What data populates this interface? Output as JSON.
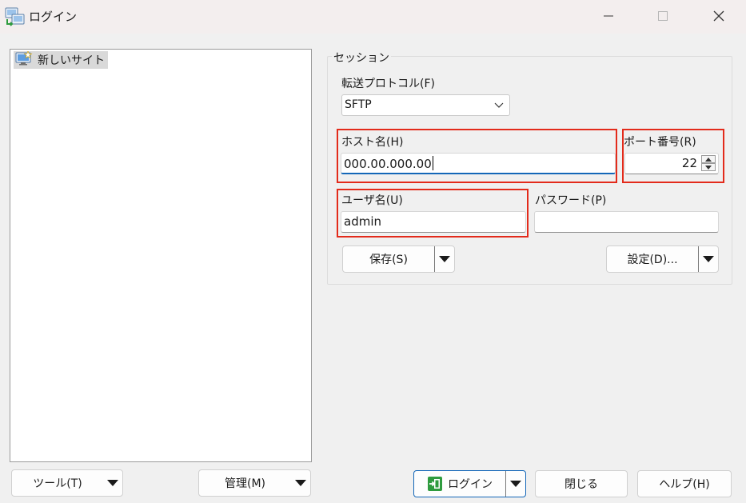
{
  "window": {
    "title": "ログイン",
    "controls": [
      "minimize-icon",
      "maximize-icon",
      "close-icon"
    ]
  },
  "sites": {
    "items": [
      {
        "label": "新しいサイト",
        "icon": "new-site-computer-icon",
        "selected": true
      }
    ]
  },
  "session": {
    "group_label": "セッション",
    "protocol": {
      "label": "転送プロトコル(F)",
      "value": "SFTP"
    },
    "host": {
      "label": "ホスト名(H)",
      "value": "000.00.000.00"
    },
    "port": {
      "label": "ポート番号(R)",
      "value": "22"
    },
    "user": {
      "label": "ユーザ名(U)",
      "value": "admin"
    },
    "password": {
      "label": "パスワード(P)",
      "value": ""
    },
    "save_button": "保存(S)",
    "advanced_button": "設定(D)..."
  },
  "footer": {
    "tools_button": "ツール(T)",
    "manage_button": "管理(M)",
    "login_button": "ログイン",
    "close_button": "閉じる",
    "help_button": "ヘルプ(H)"
  },
  "colors": {
    "highlight": "#e32b1b",
    "focus": "#1467b8",
    "login_icon": "#2e9b3e"
  }
}
